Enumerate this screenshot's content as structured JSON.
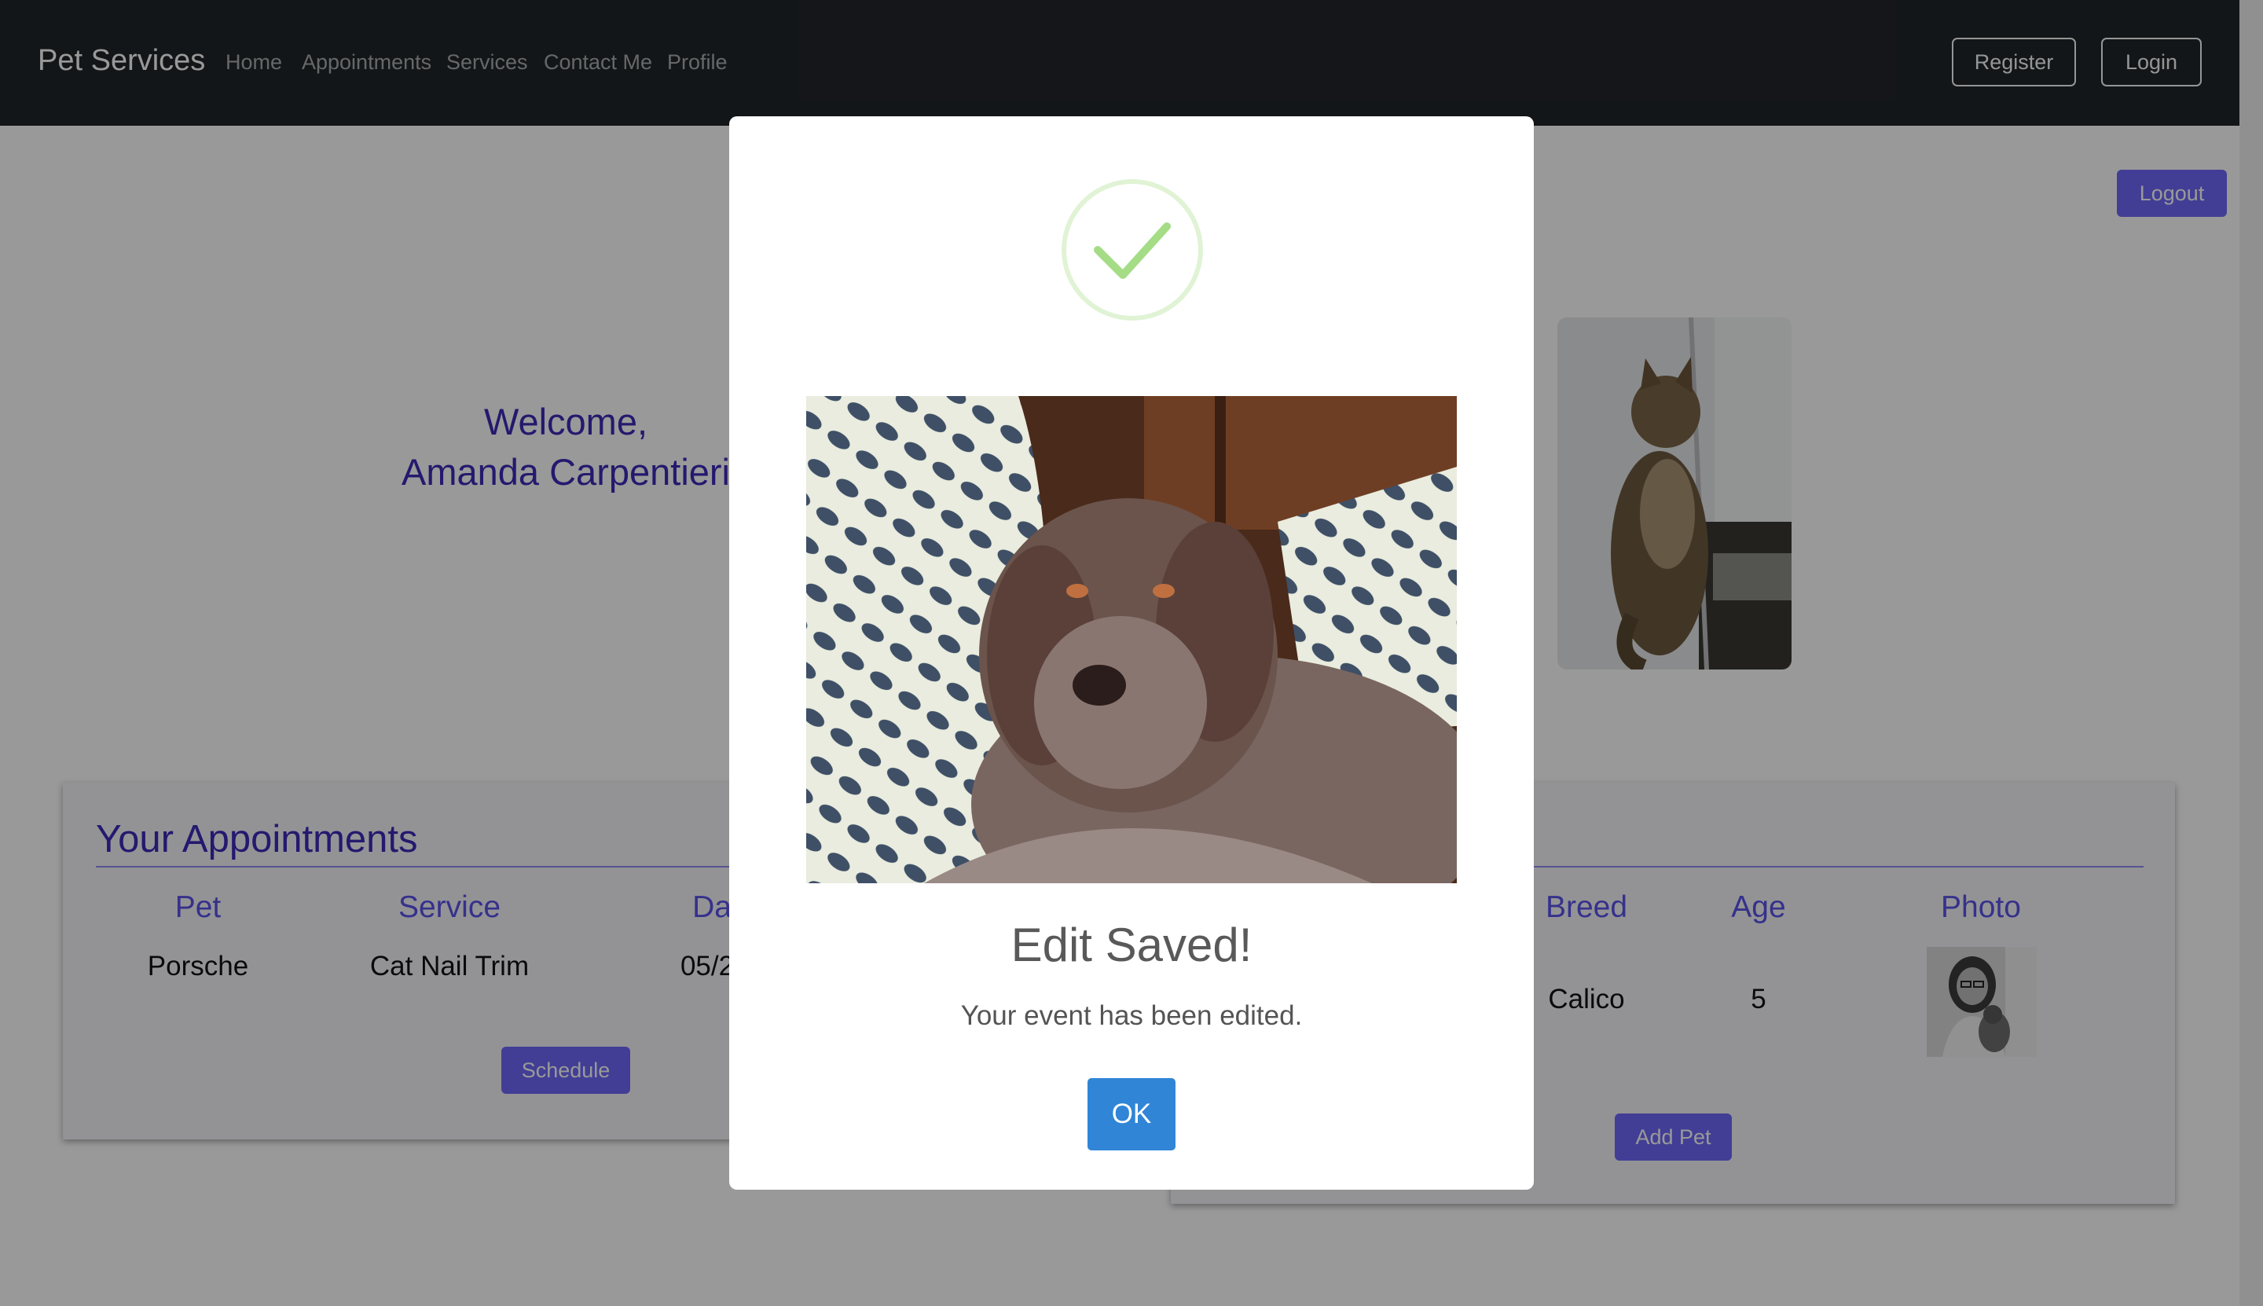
{
  "navbar": {
    "brand": "Pet Services",
    "links": [
      "Home",
      "Appointments",
      "Services",
      "Contact Me",
      "Profile"
    ],
    "register_label": "Register",
    "login_label": "Login"
  },
  "profile": {
    "logout_label": "Logout",
    "welcome_line1": "Welcome,",
    "welcome_line2": "Amanda Carpentieri"
  },
  "appointments": {
    "title": "Your Appointments",
    "columns": [
      "Pet",
      "Service",
      "Da"
    ],
    "rows": [
      {
        "pet": "Porsche",
        "service": "Cat Nail Trim",
        "date": "05/2"
      }
    ],
    "schedule_label": "Schedule"
  },
  "pets": {
    "columns": [
      "Breed",
      "Age",
      "Photo"
    ],
    "rows": [
      {
        "breed": "Calico",
        "age": "5"
      }
    ],
    "add_pet_label": "Add Pet"
  },
  "modal": {
    "title": "Edit Saved!",
    "text": "Your event has been edited.",
    "ok_label": "OK"
  },
  "colors": {
    "navbar_bg": "#212529",
    "accent": "#6f68f8",
    "heading": "#3d2ab8",
    "ok_button": "#3085d6",
    "success_check": "#a5dc86"
  }
}
